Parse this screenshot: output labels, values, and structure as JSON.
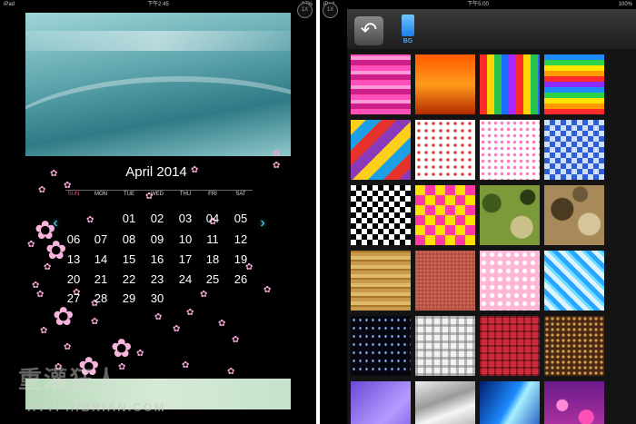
{
  "left_screen": {
    "status": {
      "device": "iPad",
      "time": "下午2:45",
      "battery": "97%"
    },
    "zoom_label": "1X",
    "calendar": {
      "title": "April 2014",
      "weekdays": [
        "SUN",
        "MON",
        "TUE",
        "WED",
        "THU",
        "FRI",
        "SAT"
      ],
      "weeks": [
        [
          "",
          "",
          "01",
          "02",
          "03",
          "04",
          "05"
        ],
        [
          "06",
          "07",
          "08",
          "09",
          "10",
          "11",
          "12"
        ],
        [
          "13",
          "14",
          "15",
          "16",
          "17",
          "18",
          "19"
        ],
        [
          "20",
          "21",
          "22",
          "23",
          "24",
          "25",
          "26"
        ],
        [
          "27",
          "28",
          "29",
          "30",
          "",
          "",
          ""
        ]
      ],
      "prev_icon": "chevron-left-icon",
      "next_icon": "chevron-right-icon"
    },
    "watermark": {
      "name": "重灌狂人",
      "url": "HTTP://BRIAN.COM"
    }
  },
  "right_screen": {
    "status": {
      "device": "iPad",
      "time": "下午5:00",
      "battery": "100%"
    },
    "zoom_label": "1X",
    "back_icon": "back-arrow-icon",
    "tab_label": "BG",
    "tab_color": "#2a8cf0",
    "backgrounds": [
      "pink-stripes",
      "orange-gradient",
      "rainbow-vertical-stripes",
      "rainbow-horizontal-stripes",
      "diagonal-color-bands",
      "red-polka-dots",
      "pink-polka-dots",
      "blue-mosaic",
      "black-white-checker",
      "colorful-squares",
      "green-camouflage",
      "brown-camouflage",
      "tan-pattern",
      "red-leather",
      "pink-hearts",
      "blue-diagonal-stripes",
      "starry-night",
      "grey-plaid",
      "red-plaid",
      "brown-polka-dots",
      "purple-gradient",
      "silver-drape",
      "blue-light-rays",
      "pink-hearts-bokeh"
    ]
  }
}
